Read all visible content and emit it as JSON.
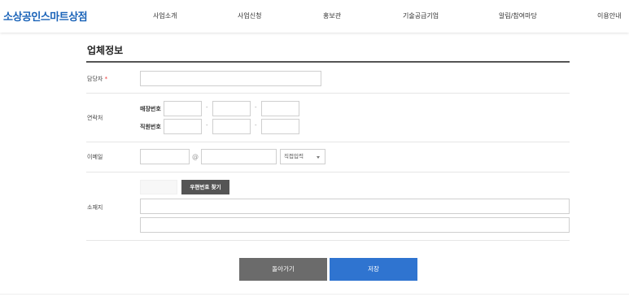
{
  "header": {
    "logo": "소상공인스마트상점",
    "nav": [
      "사업소개",
      "사업신청",
      "홍보관",
      "기술공급기업",
      "알림/참여마당",
      "이용안내"
    ]
  },
  "form": {
    "title": "업체정보",
    "manager": {
      "label": "담당자",
      "required_mark": "*",
      "value": ""
    },
    "contact": {
      "label": "연락처",
      "store_phone_label": "매장번호",
      "direct_phone_label": "직원번호",
      "separator": "-"
    },
    "email": {
      "label": "이메일",
      "at": "@",
      "domain_select": "직접입력"
    },
    "address": {
      "label": "소재지",
      "zip_button": "우편번호 찾기"
    }
  },
  "actions": {
    "back": "돌아가기",
    "save": "저장"
  },
  "colors": {
    "brand": "#1a63b8",
    "save_button": "#2f74d0",
    "back_button": "#6b6b6b"
  }
}
